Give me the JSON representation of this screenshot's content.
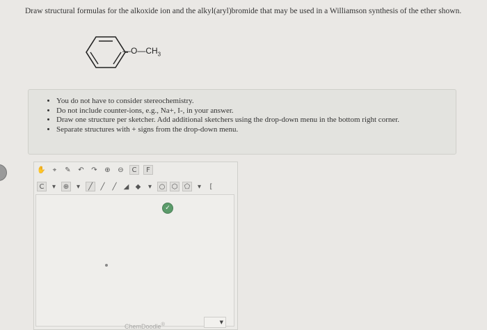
{
  "question": {
    "text": "Draw structural formulas for the alkoxide ion and the alkyl(aryl)bromide that may be used in a Williamson synthesis of the ether shown."
  },
  "molecule": {
    "bond_label": "—O—CH",
    "subscript": "3"
  },
  "instructions": [
    "You do not have to consider stereochemistry.",
    "Do not include counter-ions, e.g., Na+, I-, in your answer.",
    "Draw one structure per sketcher. Add additional sketchers using the drop-down menu in the bottom right corner.",
    "Separate structures with + signs from the drop-down menu."
  ],
  "editor": {
    "brand": "ChemDoodle",
    "brand_mark": "®",
    "toolbar1_icons": [
      "hand-icon",
      "lasso-icon",
      "eraser-icon",
      "undo-icon",
      "redo-icon",
      "zoom-in-icon",
      "zoom-out-icon",
      "atom-label-icon",
      "bond-label-icon"
    ],
    "toolbar2_icons": [
      "carbon-icon",
      "charge-icon",
      "single-bond-icon",
      "double-bond-icon",
      "triple-bond-icon",
      "wedge-bond-icon",
      "hash-bond-icon",
      "ring-icon",
      "cyclohexane-icon",
      "benzene-icon",
      "template-icon",
      "bracket-icon"
    ],
    "check_label": "✓"
  }
}
